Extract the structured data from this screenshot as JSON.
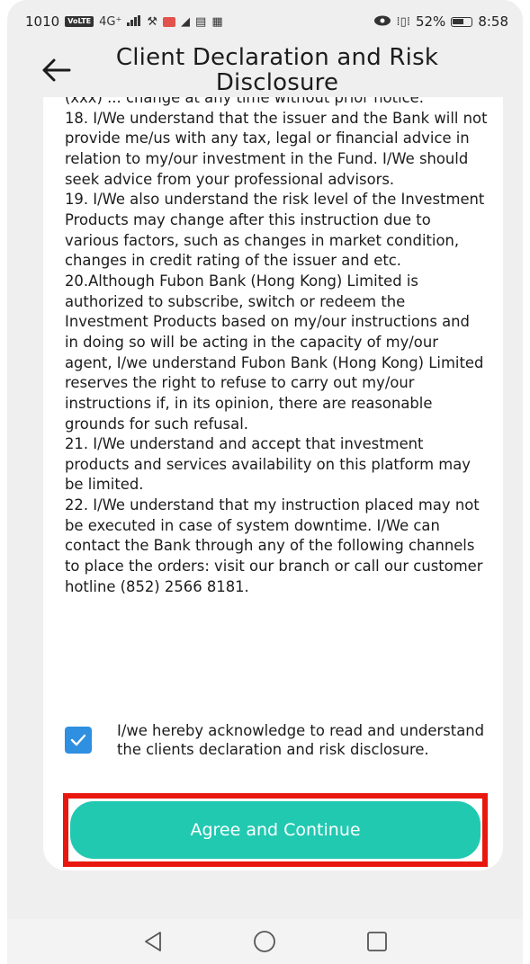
{
  "statusbar": {
    "left_text": "1010",
    "volte": "VoLTE",
    "network": "4G⁺",
    "battery_text": "52%",
    "time": "8:58"
  },
  "header": {
    "title": "Client Declaration and Risk Disclosure"
  },
  "declaration": {
    "paragraphs": [
      "(xxx) ... change at any time without prior notice.",
      "18. I/We understand that the issuer and the Bank will not provide me/us with any tax, legal or financial advice in relation to my/our investment in the Fund. I/We should seek advice from your professional advisors.",
      "19. I/We also understand the risk level of the Investment Products may change after this instruction due to various factors, such as changes in market condition, changes in credit rating of the issuer and etc.",
      "20.Although Fubon Bank (Hong Kong) Limited is authorized to subscribe, switch or redeem the Investment Products based on my/our instructions and in doing so will be acting in the capacity of my/our agent, I/we understand Fubon Bank (Hong Kong) Limited reserves the right to refuse to carry out my/our instructions if, in its opinion, there are reasonable grounds for such refusal.",
      "21. I/We understand and accept that investment products and services availability on this platform may be limited.",
      "22. I/We understand that my instruction placed may not be executed in case of system downtime. I/We can contact the Bank through any of the following channels to place the orders: visit our branch or call our customer hotline (852) 2566 8181."
    ]
  },
  "consent": {
    "checked": true,
    "label": "I/we hereby acknowledge to read and understand the clients declaration and risk disclosure."
  },
  "actions": {
    "agree_label": "Agree and Continue"
  },
  "colors": {
    "accent": "#21c9b1",
    "checkbox": "#2f8fe0",
    "highlight_frame": "#e8170f"
  }
}
